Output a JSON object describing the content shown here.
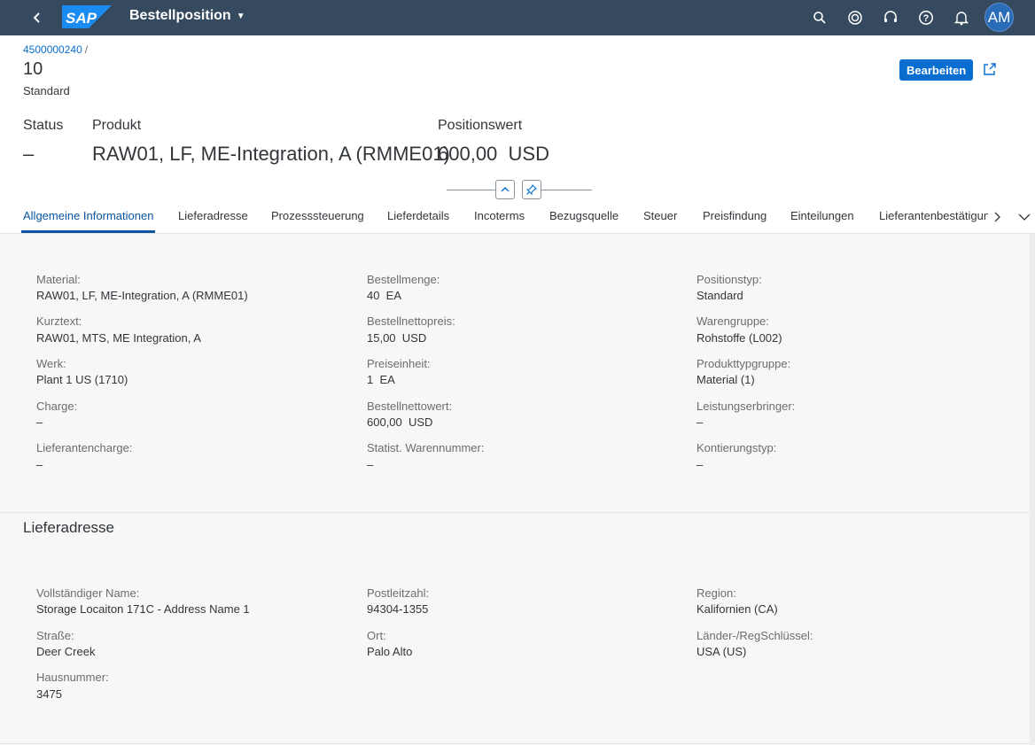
{
  "shell": {
    "logo_text": "SAP",
    "title": "Bestellposition",
    "avatar_initials": "AM",
    "colors": {
      "shell_bg": "#354a5f",
      "accent": "#0a6ed1",
      "logo": "#1a8bf0"
    }
  },
  "header": {
    "breadcrumb": "4500000240",
    "breadcrumb_sep": "/",
    "title": "10",
    "subtitle": "Standard",
    "edit_label": "Bearbeiten",
    "kpis": [
      {
        "label": "Status",
        "value": "–"
      },
      {
        "label": "Produkt",
        "value": "RAW01, LF, ME-Integration, A (RMME01)"
      },
      {
        "label": "Positionswert",
        "value": "600,00  USD"
      }
    ]
  },
  "tabs": [
    "Allgemeine Informationen",
    "Lieferadresse",
    "Prozesssteuerung",
    "Lieferdetails",
    "Incoterms",
    "Bezugsquelle",
    "Steuer",
    "Preisfindung",
    "Einteilungen",
    "Lieferantenbestätigungen"
  ],
  "general": {
    "columns": [
      [
        {
          "label": "Material:",
          "value": "RAW01, LF, ME-Integration, A (RMME01)"
        },
        {
          "label": "Kurztext:",
          "value": "RAW01, MTS, ME Integration, A"
        },
        {
          "label": "Werk:",
          "value": "Plant 1 US (1710)"
        },
        {
          "label": "Charge:",
          "value": "–"
        },
        {
          "label": "Lieferantencharge:",
          "value": "–"
        }
      ],
      [
        {
          "label": "Bestellmenge:",
          "value": "40  EA"
        },
        {
          "label": "Bestellnettopreis:",
          "value": "15,00  USD"
        },
        {
          "label": "Preiseinheit:",
          "value": "1  EA"
        },
        {
          "label": "Bestellnettowert:",
          "value": "600,00  USD"
        },
        {
          "label": "Statist. Warennummer:",
          "value": "–"
        }
      ],
      [
        {
          "label": "Positionstyp:",
          "value": "Standard"
        },
        {
          "label": "Warengruppe:",
          "value": "Rohstoffe (L002)"
        },
        {
          "label": "Produkttypgruppe:",
          "value": "Material (1)"
        },
        {
          "label": "Leistungserbringer:",
          "value": "–"
        },
        {
          "label": "Kontierungstyp:",
          "value": "–"
        }
      ]
    ]
  },
  "delivery": {
    "title": "Lieferadresse",
    "columns": [
      [
        {
          "label": "Vollständiger Name:",
          "value": "Storage Locaiton 171C - Address Name 1"
        },
        {
          "label": "Straße:",
          "value": "Deer Creek"
        },
        {
          "label": "Hausnummer:",
          "value": "3475"
        }
      ],
      [
        {
          "label": "Postleitzahl:",
          "value": "94304-1355"
        },
        {
          "label": "Ort:",
          "value": "Palo Alto"
        }
      ],
      [
        {
          "label": "Region:",
          "value": "Kalifornien (CA)"
        },
        {
          "label": "Länder-/RegSchlüssel:",
          "value": "USA (US)"
        }
      ]
    ]
  }
}
